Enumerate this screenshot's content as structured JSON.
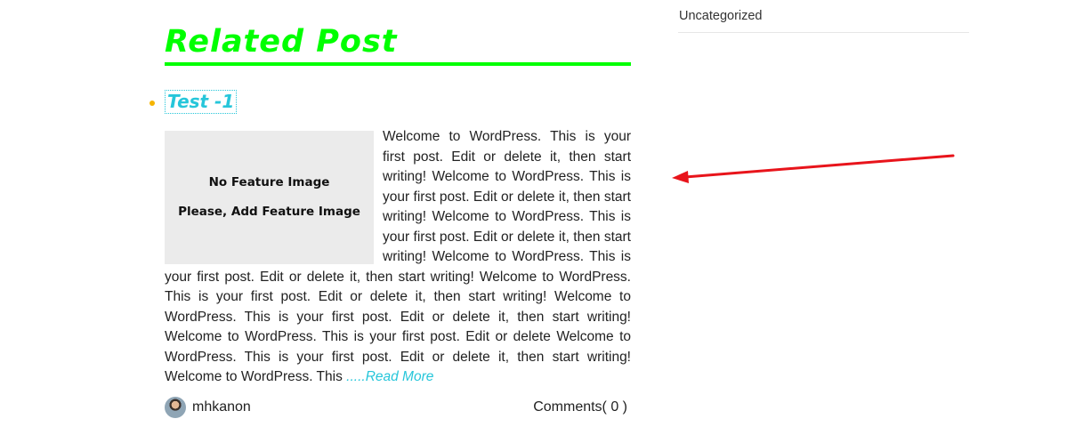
{
  "related": {
    "heading": "Related Post"
  },
  "post": {
    "title": "Test -1",
    "placeholder": {
      "line1": "No Feature Image",
      "line2": "Please, Add Feature Image"
    },
    "excerpt": "Welcome to WordPress. This is your first post. Edit or delete it, then start writing! Welcome to WordPress. This is your first post. Edit or delete it, then start writing! Welcome to WordPress. This is your first post. Edit or delete it, then start writing! Welcome to WordPress. This is your first post. Edit or delete it, then start writing! Welcome to WordPress. This is your first post. Edit or delete it, then start writing! Welcome to WordPress. This is your first post. Edit or delete it, then start writing! Welcome to WordPress. This is your first post. Edit or delete Welcome to WordPress. This is your first post. Edit or delete it, then start writing! Welcome to WordPress. This",
    "read_more": ".....Read More",
    "author": "mhkanon",
    "comments": "Comments( 0 )"
  },
  "sidebar": {
    "category": "Uncategorized"
  },
  "colors": {
    "heading": "#00ff00",
    "link": "#26c6da",
    "bullet": "#f5b400",
    "arrow": "#e8141b"
  },
  "icons": {
    "avatar": "author-avatar",
    "arrow": "annotation-arrow-icon"
  }
}
